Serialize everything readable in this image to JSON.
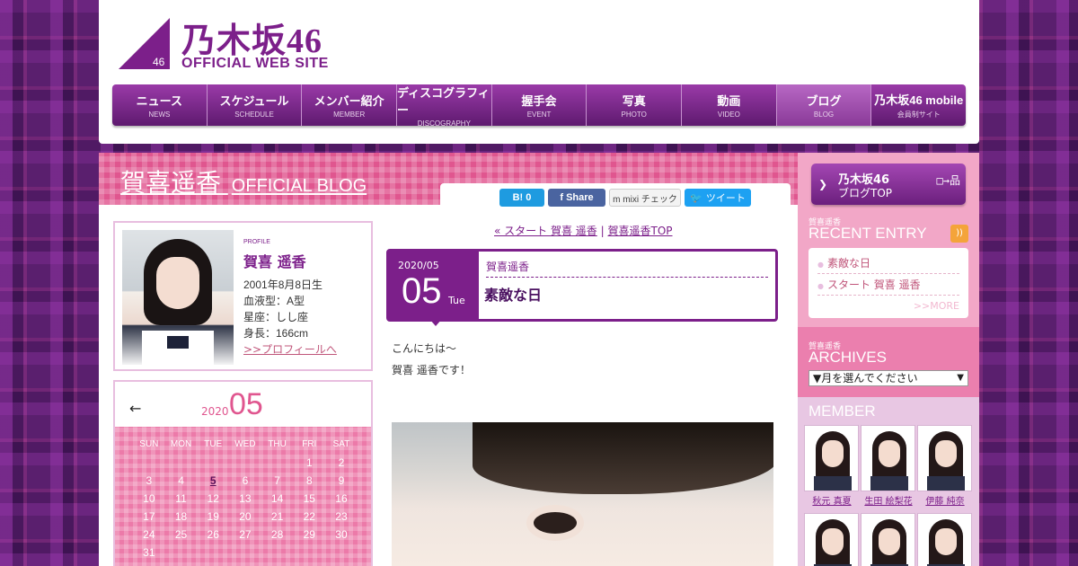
{
  "logo": {
    "title": "乃木坂46",
    "subtitle": "OFFICIAL WEB SITE",
    "triangle_number": "46"
  },
  "nav": [
    {
      "label": "ニュース",
      "sub": "NEWS"
    },
    {
      "label": "スケジュール",
      "sub": "SCHEDULE"
    },
    {
      "label": "メンバー紹介",
      "sub": "MEMBER"
    },
    {
      "label": "ディスコグラフィー",
      "sub": "DISCOGRAPHY"
    },
    {
      "label": "握手会",
      "sub": "EVENT"
    },
    {
      "label": "写真",
      "sub": "PHOTO"
    },
    {
      "label": "動画",
      "sub": "VIDEO"
    },
    {
      "label": "ブログ",
      "sub": "BLOG"
    },
    {
      "label": "乃木坂46 mobile",
      "sub": "会員制サイト"
    }
  ],
  "blog": {
    "owner": "賀喜遥香",
    "title_suffix": "OFFICIAL BLOG"
  },
  "share": {
    "hatena": "B! 0",
    "facebook": "f Share",
    "mixi": "m mixi チェック",
    "twitter": "ツイート"
  },
  "profile": {
    "label": "PROFILE",
    "name": "賀喜 遥香",
    "birthday": "2001年8月8日生",
    "blood": "血液型：A型",
    "sign": "星座：しし座",
    "height": "身長：166cm",
    "link": ">>プロフィールへ"
  },
  "calendar": {
    "prev": "←",
    "year": "2020",
    "month": "05",
    "dow": [
      "SUN",
      "MON",
      "TUE",
      "WED",
      "THU",
      "FRI",
      "SAT"
    ],
    "weeks": [
      [
        "",
        "",
        "",
        "",
        "",
        "1",
        "2"
      ],
      [
        "3",
        "4",
        "5",
        "6",
        "7",
        "8",
        "9"
      ],
      [
        "10",
        "11",
        "12",
        "13",
        "14",
        "15",
        "16"
      ],
      [
        "17",
        "18",
        "19",
        "20",
        "21",
        "22",
        "23"
      ],
      [
        "24",
        "25",
        "26",
        "27",
        "28",
        "29",
        "30"
      ],
      [
        "31",
        "",
        "",
        "",
        "",
        "",
        ""
      ]
    ],
    "linked_day": "5"
  },
  "breadcrumb": {
    "prev": "« スタート 賀喜 遥香",
    "sep": "|",
    "top": "賀喜遥香TOP"
  },
  "article": {
    "year_month": "2020/05",
    "day": "05",
    "dow": "Tue",
    "author": "賀喜遥香",
    "title": "素敵な日",
    "body": [
      "こんにちは〜",
      "賀喜 遥香です！"
    ]
  },
  "sidebar": {
    "top_button": {
      "line1": "乃木坂46",
      "line2": "ブログTOP",
      "icon": "sitemap-icon"
    },
    "recent": {
      "label": "賀喜遥香",
      "heading": "RECENT ENTRY",
      "items": [
        "素敵な日",
        "スタート 賀喜 遥香"
      ],
      "more": ">>MORE"
    },
    "archives": {
      "label": "賀喜遥香",
      "heading": "ARCHIVES",
      "select": "▼月を選んでください"
    },
    "members": {
      "heading": "MEMBER",
      "names": [
        "秋元 真夏",
        "生田 絵梨花",
        "伊藤 純奈"
      ]
    }
  },
  "colors": {
    "brand_purple": "#7c1f8a",
    "pink": "#e0568f",
    "sidebar_pink": "#f2a7c7"
  }
}
